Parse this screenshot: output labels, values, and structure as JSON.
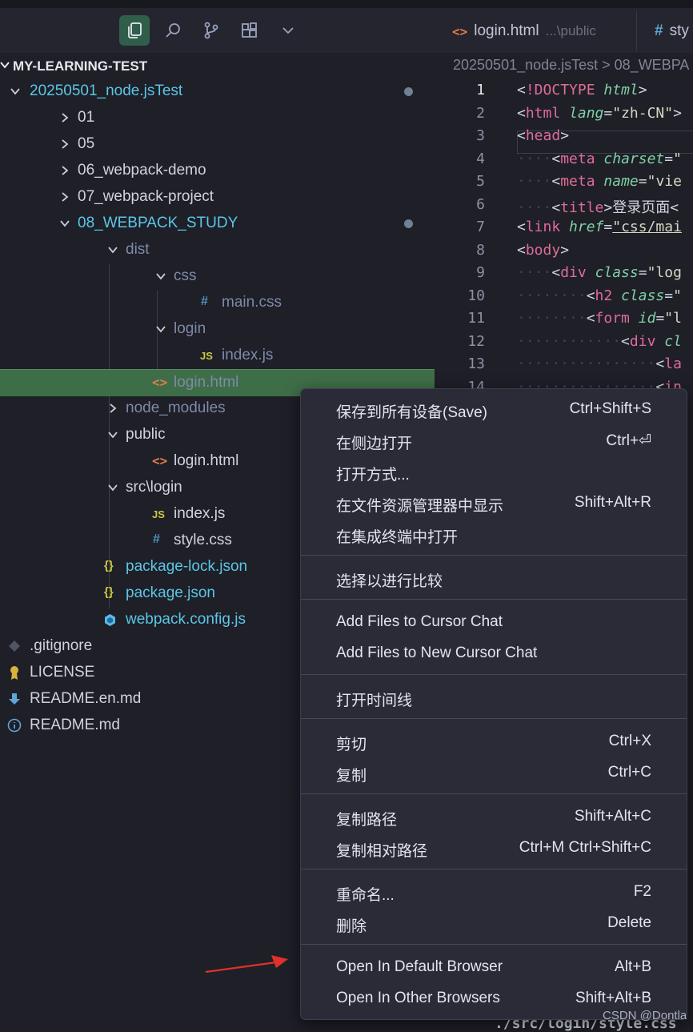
{
  "activity": {
    "icons": [
      "explorer-icon",
      "search-icon",
      "source-control-icon",
      "extensions-icon",
      "chevron-down-icon"
    ]
  },
  "tabs": [
    {
      "icon": "<>",
      "label": "login.html",
      "path": "...\\public"
    },
    {
      "icon": "#",
      "label": "sty"
    }
  ],
  "explorer": {
    "title": "MY-LEARNING-TEST",
    "items": [
      {
        "label": "20250501_node.jsTest"
      },
      {
        "label": "01"
      },
      {
        "label": "05"
      },
      {
        "label": "06_webpack-demo"
      },
      {
        "label": "07_webpack-project"
      },
      {
        "label": "08_WEBPACK_STUDY"
      },
      {
        "label": "dist"
      },
      {
        "label": "css"
      },
      {
        "icon": "#",
        "label": "main.css"
      },
      {
        "label": "login"
      },
      {
        "icon": "JS",
        "label": "index.js"
      },
      {
        "icon": "<>",
        "label": "login.html"
      },
      {
        "label": "node_modules"
      },
      {
        "label": "public"
      },
      {
        "icon": "<>",
        "label": "login.html"
      },
      {
        "label": "src\\login"
      },
      {
        "icon": "JS",
        "label": "index.js"
      },
      {
        "icon": "#",
        "label": "style.css"
      },
      {
        "icon": "{}",
        "label": "package-lock.json"
      },
      {
        "icon": "{}",
        "label": "package.json"
      },
      {
        "label": "webpack.config.js"
      },
      {
        "label": ".gitignore"
      },
      {
        "label": "LICENSE"
      },
      {
        "label": "README.en.md"
      },
      {
        "label": "README.md"
      }
    ]
  },
  "editor": {
    "breadcrumb": "20250501_node.jsTest > 08_WEBPA",
    "line_numbers": [
      "1",
      "2",
      "3",
      "4",
      "5",
      "6",
      "7",
      "8",
      "9",
      "10",
      "11",
      "12",
      "13",
      "14"
    ],
    "bottom_code": "./src/login/style.css"
  },
  "context_menu": {
    "groups": [
      [
        {
          "label": "保存到所有设备(Save)",
          "shortcut": "Ctrl+Shift+S"
        },
        {
          "label": "在侧边打开",
          "shortcut": "Ctrl+⏎"
        },
        {
          "label": "打开方式...",
          "shortcut": ""
        },
        {
          "label": "在文件资源管理器中显示",
          "shortcut": "Shift+Alt+R"
        },
        {
          "label": "在集成终端中打开",
          "shortcut": ""
        }
      ],
      [
        {
          "label": "选择以进行比较",
          "shortcut": ""
        }
      ],
      [
        {
          "label": "Add Files to Cursor Chat",
          "shortcut": ""
        },
        {
          "label": "Add Files to New Cursor Chat",
          "shortcut": ""
        }
      ],
      [
        {
          "label": "打开时间线",
          "shortcut": ""
        }
      ],
      [
        {
          "label": "剪切",
          "shortcut": "Ctrl+X"
        },
        {
          "label": "复制",
          "shortcut": "Ctrl+C"
        }
      ],
      [
        {
          "label": "复制路径",
          "shortcut": "Shift+Alt+C"
        },
        {
          "label": "复制相对路径",
          "shortcut": "Ctrl+M Ctrl+Shift+C"
        }
      ],
      [
        {
          "label": "重命名...",
          "shortcut": "F2"
        },
        {
          "label": "删除",
          "shortcut": "Delete"
        }
      ],
      [
        {
          "label": "Open In Default Browser",
          "shortcut": "Alt+B"
        },
        {
          "label": "Open In Other Browsers",
          "shortcut": "Shift+Alt+B"
        }
      ]
    ]
  },
  "watermark": "CSDN @Dontla",
  "colors": {
    "accent": "#2f5f4a",
    "selected_row": "#3e6e47",
    "arrow": "#e0302a"
  }
}
